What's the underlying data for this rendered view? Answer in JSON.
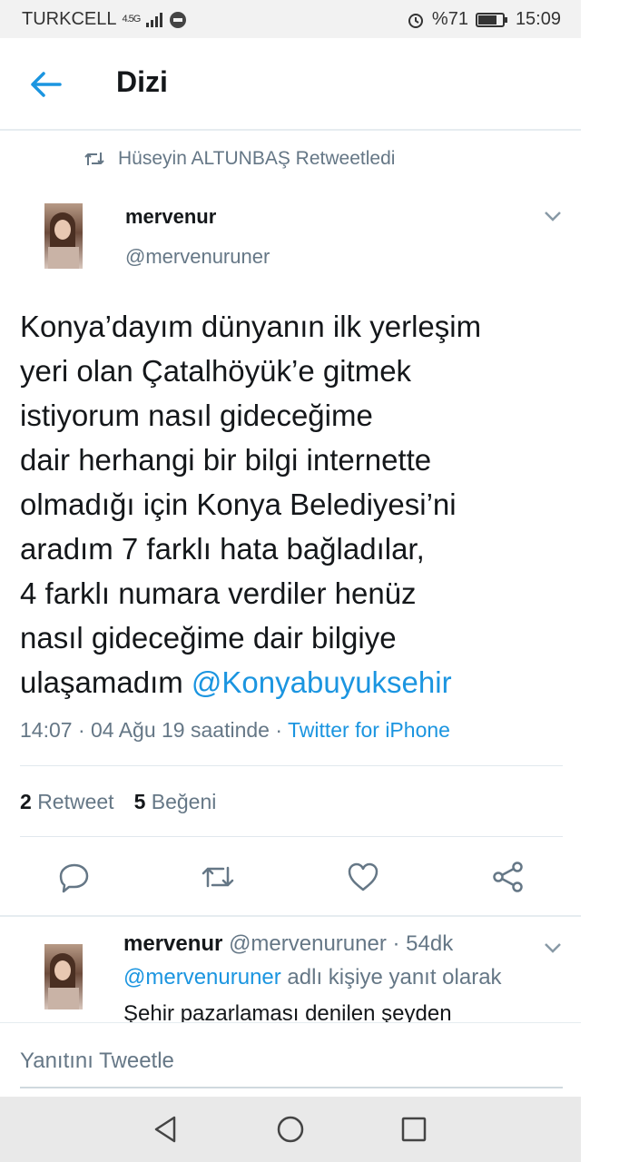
{
  "status_bar": {
    "carrier": "TURKCELL",
    "network": "4.5G",
    "battery_percent": "%71",
    "time": "15:09"
  },
  "header": {
    "title": "Dizi"
  },
  "retweet_context": {
    "text": "Hüseyin ALTUNBAŞ Retweetledi"
  },
  "tweet": {
    "author_name": "mervenur",
    "author_handle": "@mervenuruner",
    "text_lines": [
      "Konya’dayım dünyanın ilk yerleşim",
      "yeri olan Çatalhöyük’e gitmek",
      "istiyorum nasıl gideceğime",
      "dair herhangi bir bilgi internette",
      "olmadığı için Konya Belediyesi’ni",
      "aradım 7 farklı hata bağladılar,",
      "4 farklı numara verdiler henüz",
      "nasıl gideceğime dair bilgiye",
      "ulaşamadım "
    ],
    "mention": "@Konyabuyuksehir",
    "timestamp": "14:07 · 04 Ağu 19 saatinde · ",
    "source": "Twitter for iPhone",
    "retweet_count": "2",
    "retweet_label": "Retweet",
    "like_count": "5",
    "like_label": "Beğeni"
  },
  "icons": {
    "reply": "reply-icon",
    "retweet": "retweet-icon",
    "like": "heart-icon",
    "share": "share-icon"
  },
  "reply_tweet": {
    "author_name": "mervenur",
    "author_handle": "@mervenuruner · 54dk",
    "replying_to_mention": "@mervenuruner",
    "replying_to_suffix": " adlı kişiye yanıt olarak",
    "text": "Şehir pazarlaması denilen şeyden"
  },
  "composer": {
    "placeholder": "Yanıtını Tweetle"
  },
  "colors": {
    "accent": "#1b95e0",
    "secondary_text": "#657786"
  }
}
